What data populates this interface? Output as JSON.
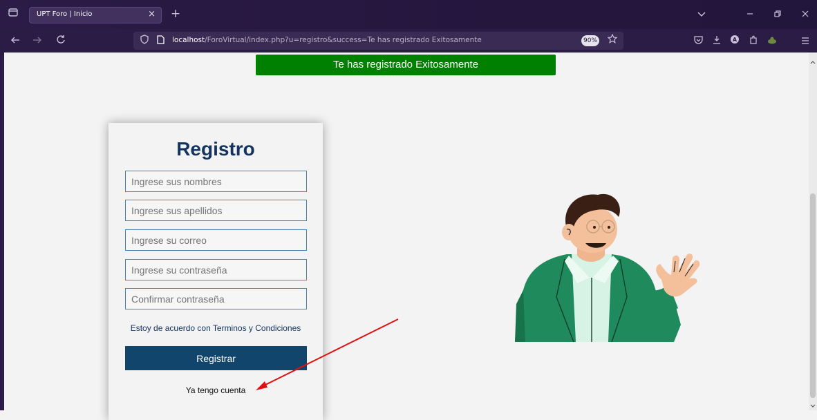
{
  "browser": {
    "tab_title": "UPT Foro | Inicio",
    "tab_close": "×",
    "new_tab": "+",
    "url_host": "localhost",
    "url_path": "/ForoVirtual/index.php?u=registro&success=Te has registrado Exitosamente",
    "zoom": "90%",
    "icons": [
      "tab-overview-icon",
      "back-icon",
      "forward-icon",
      "reload-icon",
      "shield-icon",
      "page-icon",
      "star-icon",
      "pocket-icon",
      "download-icon",
      "account-icon",
      "extensions-icon",
      "addon-icon",
      "menu-icon",
      "minimize-icon",
      "restore-icon",
      "close-icon",
      "list-tabs-icon"
    ]
  },
  "banner": {
    "text": "Te has registrado Exitosamente",
    "color": "#008000"
  },
  "form": {
    "title": "Registro",
    "fields": [
      {
        "placeholder": "Ingrese sus nombres",
        "value": ""
      },
      {
        "placeholder": "Ingrese sus apellidos",
        "value": ""
      },
      {
        "placeholder": "Ingrese su correo",
        "value": ""
      },
      {
        "placeholder": "Ingrese su contraseña",
        "value": ""
      },
      {
        "placeholder": "Confirmar contraseña",
        "value": ""
      }
    ],
    "terms": "Estoy de acuerdo con Terminos y Condiciones",
    "submit": "Registrar",
    "login_link": "Ya tengo cuenta"
  },
  "colors": {
    "accent": "#12456b",
    "title": "#12345e",
    "annotation_arrow": "#e01010"
  }
}
